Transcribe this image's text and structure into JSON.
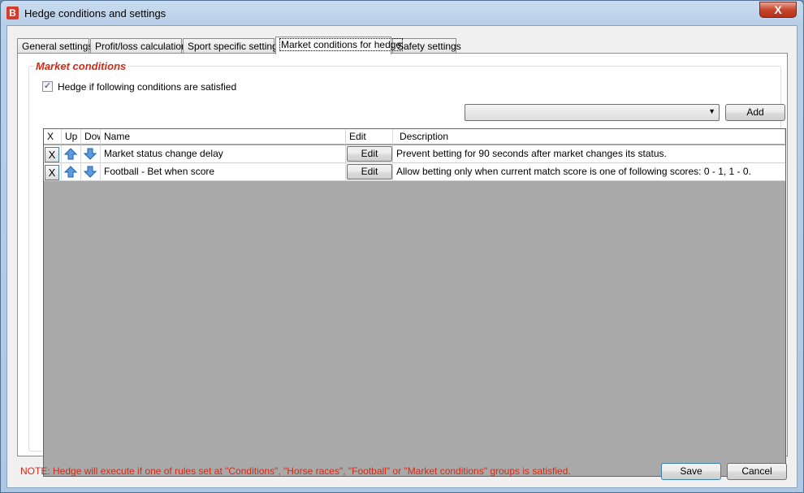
{
  "window": {
    "title": "Hedge conditions and settings",
    "app_icon_letter": "B",
    "close_label": "X"
  },
  "tabs": [
    {
      "label": "General settings"
    },
    {
      "label": "Profit/loss calculation"
    },
    {
      "label": "Sport specific settings"
    },
    {
      "label": "Market conditions for hedge"
    },
    {
      "label": "Safety settings"
    }
  ],
  "market_conditions": {
    "group_title": "Market conditions",
    "hedge_checkbox_label": "Hedge if following conditions are satisfied",
    "hedge_checked": true,
    "combo_value": "",
    "add_label": "Add"
  },
  "grid": {
    "columns": [
      "X",
      "Up",
      "Down",
      "Name",
      "Edit",
      "Description"
    ],
    "rows": [
      {
        "delete_label": "X",
        "name": "Market status change delay",
        "edit_label": "Edit",
        "description": "Prevent betting for 90 seconds after market changes its status."
      },
      {
        "delete_label": "X",
        "name": "Football - Bet when score",
        "edit_label": "Edit",
        "description": "Allow betting only when current match score is one of following scores: 0 - 1, 1 - 0."
      }
    ]
  },
  "footer": {
    "note": "NOTE: Hedge will execute if one of rules set at \"Conditions\", \"Horse races\", \"Football\" or \"Market conditions\" groups is satisfied.",
    "save_label": "Save",
    "cancel_label": "Cancel"
  },
  "colors": {
    "accent_red": "#d22b17",
    "grid_empty": "#a9a9a9",
    "titlebar": "#c9dcf0"
  }
}
